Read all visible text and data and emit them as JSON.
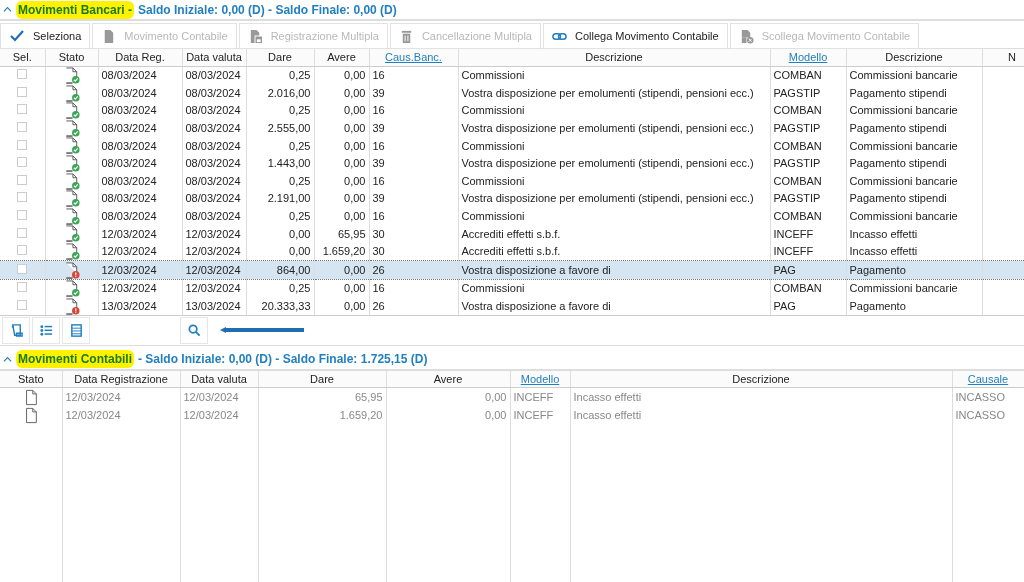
{
  "bank_section": {
    "title": "Movimenti Bancari -",
    "summary": "Saldo Iniziale: 0,00 (D) - Saldo Finale: 0,00 (D)",
    "expanded": true,
    "toolbar": [
      {
        "label": "Seleziona",
        "kind": "check",
        "disabled": false
      },
      {
        "label": "Movimento Contabile",
        "kind": "doc",
        "disabled": true
      },
      {
        "label": "Registrazione Multipla",
        "kind": "docs",
        "disabled": true
      },
      {
        "label": "Cancellazione Multipla",
        "kind": "trash",
        "disabled": true
      },
      {
        "label": "Collega Movimento Contabile",
        "kind": "link",
        "disabled": false
      },
      {
        "label": "Scollega Movimento Contabile",
        "kind": "unlink",
        "disabled": true
      }
    ],
    "table": {
      "columns": [
        {
          "label": "Sel.",
          "link": false
        },
        {
          "label": "Stato",
          "link": false
        },
        {
          "label": "Data Reg.",
          "link": false
        },
        {
          "label": "Data valuta",
          "link": false
        },
        {
          "label": "Dare",
          "link": false
        },
        {
          "label": "Avere",
          "link": false
        },
        {
          "label": "Caus.Banc.",
          "link": true
        },
        {
          "label": "Descrizione",
          "link": false
        },
        {
          "label": "Modello",
          "link": true
        },
        {
          "label": "Descrizione",
          "link": false
        },
        {
          "label": "N",
          "link": false
        }
      ],
      "rows": [
        {
          "checked": false,
          "error": false,
          "selected": false,
          "cells": [
            "",
            "",
            "08/03/2024",
            "08/03/2024",
            "0,25",
            "0,00",
            "16",
            "Commissioni",
            "COMBAN",
            "Commissioni bancarie"
          ]
        },
        {
          "checked": false,
          "error": false,
          "selected": false,
          "cells": [
            "",
            "",
            "08/03/2024",
            "08/03/2024",
            "2.016,00",
            "0,00",
            "39",
            "Vostra disposizione per emolumenti (stipendi, pensioni ecc.)",
            "PAGSTIP",
            "Pagamento stipendi"
          ]
        },
        {
          "checked": false,
          "error": false,
          "selected": false,
          "cells": [
            "",
            "",
            "08/03/2024",
            "08/03/2024",
            "0,25",
            "0,00",
            "16",
            "Commissioni",
            "COMBAN",
            "Commissioni bancarie"
          ]
        },
        {
          "checked": false,
          "error": false,
          "selected": false,
          "cells": [
            "",
            "",
            "08/03/2024",
            "08/03/2024",
            "2.555,00",
            "0,00",
            "39",
            "Vostra disposizione per emolumenti (stipendi, pensioni ecc.)",
            "PAGSTIP",
            "Pagamento stipendi"
          ]
        },
        {
          "checked": false,
          "error": false,
          "selected": false,
          "cells": [
            "",
            "",
            "08/03/2024",
            "08/03/2024",
            "0,25",
            "0,00",
            "16",
            "Commissioni",
            "COMBAN",
            "Commissioni bancarie"
          ]
        },
        {
          "checked": false,
          "error": false,
          "selected": false,
          "cells": [
            "",
            "",
            "08/03/2024",
            "08/03/2024",
            "1.443,00",
            "0,00",
            "39",
            "Vostra disposizione per emolumenti (stipendi, pensioni ecc.)",
            "PAGSTIP",
            "Pagamento stipendi"
          ]
        },
        {
          "checked": false,
          "error": false,
          "selected": false,
          "cells": [
            "",
            "",
            "08/03/2024",
            "08/03/2024",
            "0,25",
            "0,00",
            "16",
            "Commissioni",
            "COMBAN",
            "Commissioni bancarie"
          ]
        },
        {
          "checked": false,
          "error": false,
          "selected": false,
          "cells": [
            "",
            "",
            "08/03/2024",
            "08/03/2024",
            "2.191,00",
            "0,00",
            "39",
            "Vostra disposizione per emolumenti (stipendi, pensioni ecc.)",
            "PAGSTIP",
            "Pagamento stipendi"
          ]
        },
        {
          "checked": false,
          "error": false,
          "selected": false,
          "cells": [
            "",
            "",
            "08/03/2024",
            "08/03/2024",
            "0,25",
            "0,00",
            "16",
            "Commissioni",
            "COMBAN",
            "Commissioni bancarie"
          ]
        },
        {
          "checked": false,
          "error": false,
          "selected": false,
          "cells": [
            "",
            "",
            "12/03/2024",
            "12/03/2024",
            "0,00",
            "65,95",
            "30",
            "Accrediti effetti s.b.f.",
            "INCEFF",
            "Incasso effetti"
          ]
        },
        {
          "checked": false,
          "error": false,
          "selected": false,
          "cells": [
            "",
            "",
            "12/03/2024",
            "12/03/2024",
            "0,00",
            "1.659,20",
            "30",
            "Accrediti effetti s.b.f.",
            "INCEFF",
            "Incasso effetti"
          ]
        },
        {
          "checked": false,
          "error": true,
          "selected": true,
          "cells": [
            "",
            "",
            "12/03/2024",
            "12/03/2024",
            "864,00",
            "0,00",
            "26",
            "Vostra disposizione a favore di",
            "PAG",
            "Pagamento"
          ]
        },
        {
          "checked": false,
          "error": false,
          "selected": false,
          "cells": [
            "",
            "",
            "12/03/2024",
            "12/03/2024",
            "0,25",
            "0,00",
            "16",
            "Commissioni",
            "COMBAN",
            "Commissioni bancarie"
          ]
        },
        {
          "checked": false,
          "error": true,
          "selected": false,
          "cells": [
            "",
            "",
            "13/03/2024",
            "13/03/2024",
            "20.333,33",
            "0,00",
            "26",
            "Vostra disposizione a favore di",
            "PAG",
            "Pagamento"
          ]
        }
      ]
    },
    "bottom_toolbar": [
      {
        "kind": "scroll"
      },
      {
        "kind": "list"
      },
      {
        "kind": "rows"
      },
      {
        "kind": "search"
      }
    ]
  },
  "accounting_section": {
    "title": "Movimenti Contabili",
    "summary": "- Saldo Iniziale: 0,00 (D) - Saldo Finale: 1.725,15 (D)",
    "expanded": true,
    "table": {
      "columns": [
        {
          "label": "Stato",
          "link": false
        },
        {
          "label": "Data Registrazione",
          "link": false
        },
        {
          "label": "Data valuta",
          "link": false
        },
        {
          "label": "Dare",
          "link": false
        },
        {
          "label": "Avere",
          "link": false
        },
        {
          "label": "Modello",
          "link": true
        },
        {
          "label": "Descrizione",
          "link": false
        },
        {
          "label": "Causale",
          "link": true
        }
      ],
      "rows": [
        {
          "cells": [
            "",
            "12/03/2024",
            "12/03/2024",
            "65,95",
            "0,00",
            "INCEFF",
            "Incasso effetti",
            "INCASSO"
          ]
        },
        {
          "cells": [
            "",
            "12/03/2024",
            "12/03/2024",
            "1.659,20",
            "0,00",
            "INCEFF",
            "Incasso effetti",
            "INCASSO"
          ]
        }
      ]
    }
  }
}
